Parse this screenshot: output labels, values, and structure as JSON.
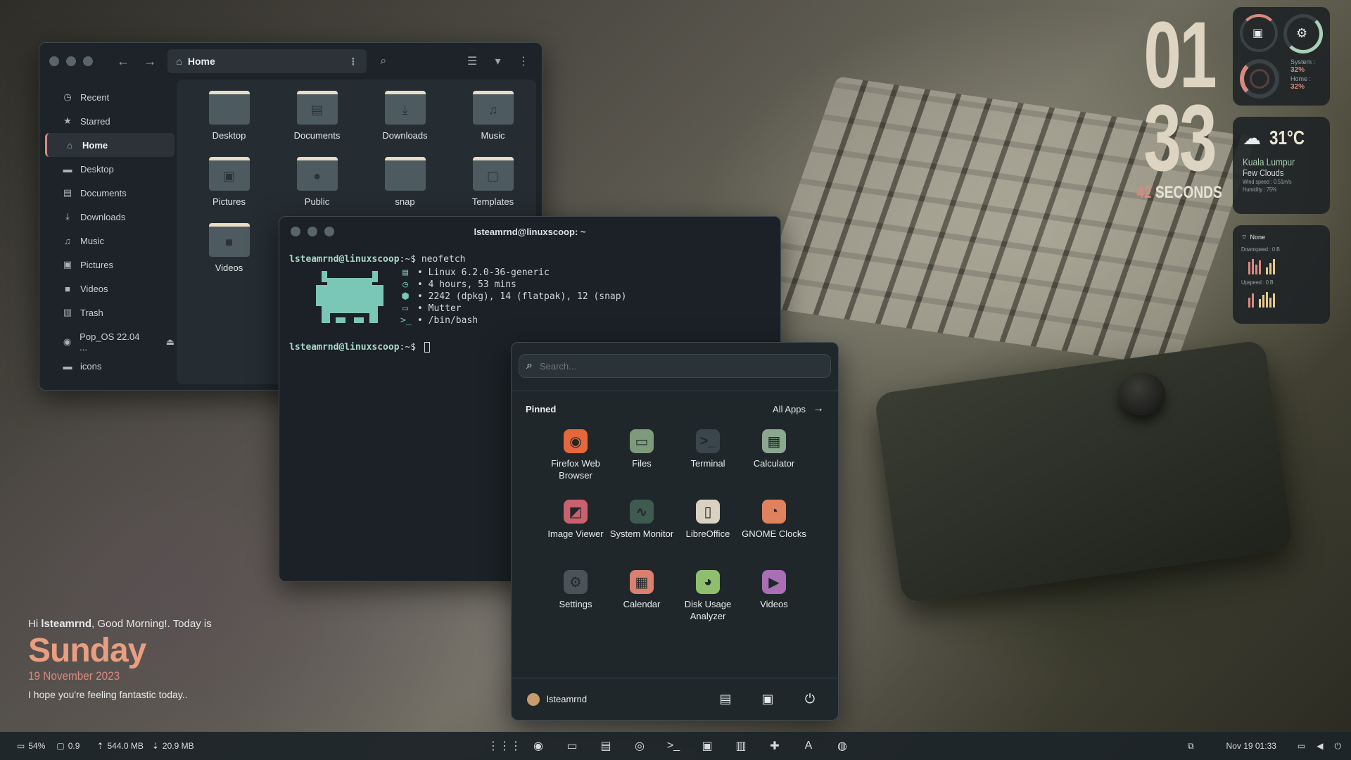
{
  "file_manager": {
    "path": "Home",
    "sidebar": [
      {
        "label": "Recent",
        "icon": "clock-icon",
        "glyph": "◷"
      },
      {
        "label": "Starred",
        "icon": "star-icon",
        "glyph": "★"
      },
      {
        "label": "Home",
        "icon": "home-icon",
        "glyph": "⌂",
        "active": true
      },
      {
        "label": "Desktop",
        "icon": "desktop-icon",
        "glyph": "▬"
      },
      {
        "label": "Documents",
        "icon": "document-icon",
        "glyph": "▤"
      },
      {
        "label": "Downloads",
        "icon": "download-icon",
        "glyph": "⤓"
      },
      {
        "label": "Music",
        "icon": "music-icon",
        "glyph": "♫"
      },
      {
        "label": "Pictures",
        "icon": "picture-icon",
        "glyph": "▣"
      },
      {
        "label": "Videos",
        "icon": "video-icon",
        "glyph": "■"
      },
      {
        "label": "Trash",
        "icon": "trash-icon",
        "glyph": "▥"
      }
    ],
    "drives": [
      {
        "label": "Pop_OS 22.04 ...",
        "icon": "disk-icon",
        "glyph": "◉"
      },
      {
        "label": "icons",
        "icon": "folder-icon",
        "glyph": "▬"
      }
    ],
    "folders": [
      {
        "name": "Desktop",
        "glyph": ""
      },
      {
        "name": "Documents",
        "glyph": "▤"
      },
      {
        "name": "Downloads",
        "glyph": "⤓"
      },
      {
        "name": "Music",
        "glyph": "♫"
      },
      {
        "name": "Pictures",
        "glyph": "▣"
      },
      {
        "name": "Public",
        "glyph": "●"
      },
      {
        "name": "snap",
        "glyph": ""
      },
      {
        "name": "Templates",
        "glyph": "▢"
      },
      {
        "name": "Videos",
        "glyph": "■"
      }
    ]
  },
  "terminal": {
    "title": "lsteamrnd@linuxscoop: ~",
    "prompt": "lsteamrnd@linuxscoop",
    "prompt_suffix": ":~$ ",
    "command": "neofetch",
    "info": [
      "• Linux 6.2.0-36-generic",
      "• 4 hours, 53 mins",
      "• 2242 (dpkg), 14 (flatpak), 12 (snap)",
      "• Mutter",
      "• /bin/bash"
    ]
  },
  "menu": {
    "search_placeholder": "Search...",
    "pinned_label": "Pinned",
    "all_apps_label": "All Apps",
    "apps": [
      {
        "name": "Firefox Web Browser",
        "icon": "firefox-icon",
        "glyph": "◉",
        "color": "#e4683c"
      },
      {
        "name": "Files",
        "icon": "files-icon",
        "glyph": "▭",
        "color": "#7d9b7a"
      },
      {
        "name": "Terminal",
        "icon": "terminal-icon",
        "glyph": ">_",
        "color": "#3b464c"
      },
      {
        "name": "Calculator",
        "icon": "calculator-icon",
        "glyph": "▦",
        "color": "#8aa88e"
      },
      {
        "name": "Image Viewer",
        "icon": "image-viewer-icon",
        "glyph": "◩",
        "color": "#c9616e"
      },
      {
        "name": "System Monitor",
        "icon": "system-monitor-icon",
        "glyph": "∿",
        "color": "#3f5a4f"
      },
      {
        "name": "LibreOffice",
        "icon": "libreoffice-icon",
        "glyph": "▯",
        "color": "#d9d2c2"
      },
      {
        "name": "GNOME Clocks",
        "icon": "clock-app-icon",
        "glyph": "◔",
        "color": "#e0825e"
      },
      {
        "name": "Settings",
        "icon": "settings-icon",
        "glyph": "⚙",
        "color": "#4a5358"
      },
      {
        "name": "Calendar",
        "icon": "calendar-icon",
        "glyph": "▦",
        "color": "#d9806e"
      },
      {
        "name": "Disk Usage Analyzer",
        "icon": "disk-usage-icon",
        "glyph": "◕",
        "color": "#8fbf6e"
      },
      {
        "name": "Videos",
        "icon": "videos-app-icon",
        "glyph": "▶",
        "color": "#a86fb5"
      }
    ],
    "username": "lsteamrnd"
  },
  "clock": {
    "hours": "01",
    "minutes": "33",
    "seconds": "42",
    "seconds_label": "SECONDS"
  },
  "system": {
    "system_label": "System :",
    "system_value": "32%",
    "home_label": "Home :",
    "home_value": "32%"
  },
  "weather": {
    "temp": "31°C",
    "city": "Kuala Lumpur",
    "condition": "Few Clouds",
    "wind": "Wind speed : 0.51m/s",
    "humidity": "Humidity : 75%"
  },
  "network": {
    "name": "None",
    "down": "Downspeed : 0 B",
    "up": "Upspeed : 0 B"
  },
  "greeting": {
    "prefix": "Hi ",
    "user": "lsteamrnd",
    "suffix": ", Good Morning!. Today is",
    "day": "Sunday",
    "date": "19 November 2023",
    "message": "I hope you're feeling fantastic today.."
  },
  "panel": {
    "battery": "54%",
    "load": "0.9",
    "ram": "544.0 MB",
    "swap": "20.9 MB",
    "dock": [
      {
        "icon": "app-grid-icon",
        "glyph": "⋮⋮⋮"
      },
      {
        "icon": "firefox-icon",
        "glyph": "◉"
      },
      {
        "icon": "files-icon",
        "glyph": "▭"
      },
      {
        "icon": "text-editor-icon",
        "glyph": "▤"
      },
      {
        "icon": "help-icon",
        "glyph": "◎"
      },
      {
        "icon": "terminal-icon",
        "glyph": ">_"
      },
      {
        "icon": "disk-icon",
        "glyph": "▣"
      },
      {
        "icon": "software-icon",
        "glyph": "▥"
      },
      {
        "icon": "extensions-icon",
        "glyph": "✚"
      },
      {
        "icon": "font-viewer-icon",
        "glyph": "A"
      },
      {
        "icon": "spotify-icon",
        "glyph": "◍"
      }
    ],
    "datetime": "Nov 19  01:33"
  }
}
